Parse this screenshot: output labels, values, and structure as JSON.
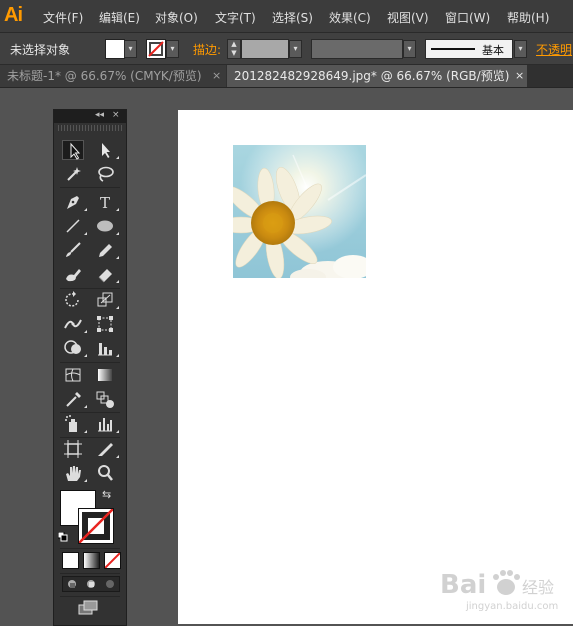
{
  "app": {
    "logo": "Ai"
  },
  "menu": {
    "items": [
      {
        "label": "文件(F)"
      },
      {
        "label": "编辑(E)"
      },
      {
        "label": "对象(O)"
      },
      {
        "label": "文字(T)"
      },
      {
        "label": "选择(S)"
      },
      {
        "label": "效果(C)"
      },
      {
        "label": "视图(V)"
      },
      {
        "label": "窗口(W)"
      },
      {
        "label": "帮助(H)"
      }
    ]
  },
  "control_bar": {
    "selection_status": "未选择对象",
    "stroke_label": "描边:",
    "brush_label": "基本",
    "opacity_label": "不透明",
    "fill_color": "#ffffff",
    "stroke_weight_color": "#a8a8a8"
  },
  "tabs": [
    {
      "label": "未标题-1* @ 66.67% (CMYK/预览)",
      "close": "×",
      "active": false
    },
    {
      "label": "201282482928649.jpg* @ 66.67% (RGB/预览)",
      "close": "×",
      "active": true
    }
  ],
  "tools_panel": {
    "collapse_icon": "◂◂",
    "close_icon": "×",
    "tools": [
      "selection-tool",
      "direct-selection-tool",
      "magic-wand-tool",
      "lasso-tool",
      "pen-tool",
      "type-tool",
      "line-segment-tool",
      "ellipse-tool",
      "paintbrush-tool",
      "pencil-tool",
      "blob-brush-tool",
      "eraser-tool",
      "rotate-tool",
      "scale-tool",
      "width-tool",
      "free-transform-tool",
      "shape-builder-tool",
      "column-graph-tool",
      "mesh-tool",
      "gradient-tool",
      "eyedropper-tool",
      "blend-tool",
      "symbol-sprayer-tool",
      "column-graph-tool-2",
      "artboard-tool",
      "slice-tool",
      "hand-tool",
      "zoom-tool"
    ],
    "fill_color": "#ffffff",
    "stroke_color": "none",
    "accent_color": "#e8231f"
  },
  "canvas": {
    "artboard_color": "#ffffff",
    "placed_image": "daisy-sky-photo"
  },
  "watermark": {
    "text": "Bai 经验",
    "subtext": "jingyan.baidu.com"
  }
}
